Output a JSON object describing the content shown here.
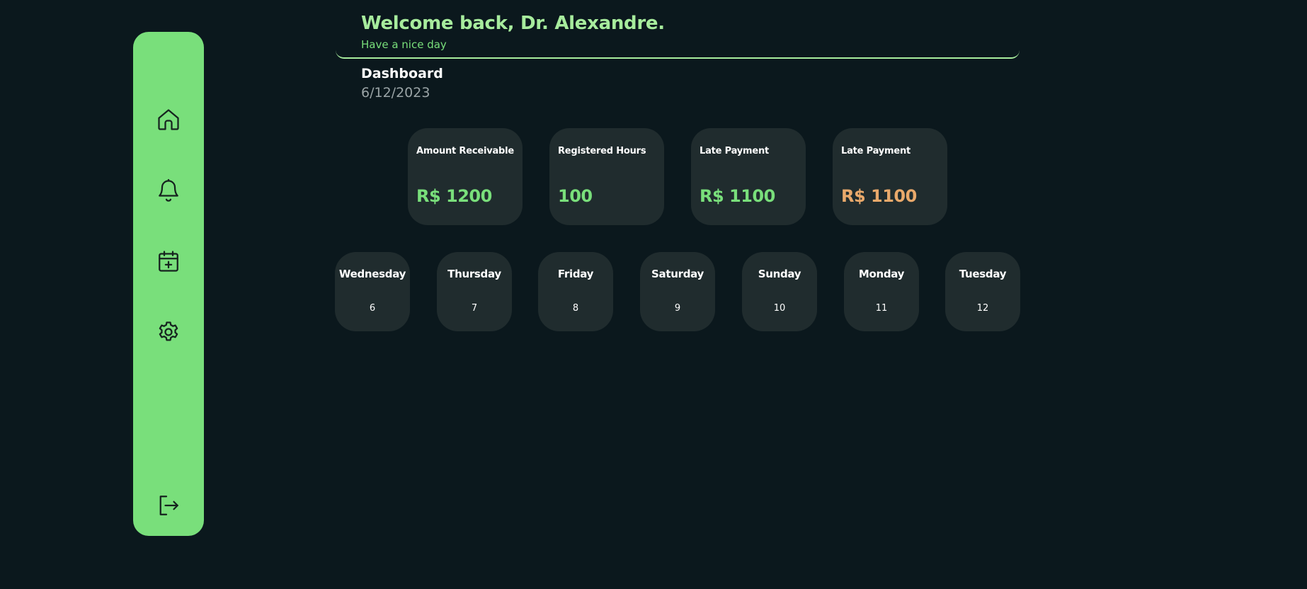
{
  "sidebar": {
    "items": [
      {
        "icon": "home-icon"
      },
      {
        "icon": "bell-icon"
      },
      {
        "icon": "calendar-plus-icon"
      },
      {
        "icon": "gear-icon"
      },
      {
        "icon": "logout-icon"
      }
    ]
  },
  "header": {
    "welcome": "Welcome back, Dr. Alexandre.",
    "subtitle": "Have a nice day"
  },
  "page": {
    "title": "Dashboard",
    "date": "6/12/2023"
  },
  "stats": [
    {
      "label": "Amount Receivable",
      "value": "R$ 1200",
      "color": "#79df7b"
    },
    {
      "label": "Registered Hours",
      "value": "100",
      "color": "#79df7b"
    },
    {
      "label": "Late Payment",
      "value": "R$ 1100",
      "color": "#79df7b"
    },
    {
      "label": "Late Payment",
      "value": "R$ 1100",
      "color": "#e9a96b"
    }
  ],
  "days": [
    {
      "name": "Wednesday",
      "number": "6"
    },
    {
      "name": "Thursday",
      "number": "7"
    },
    {
      "name": "Friday",
      "number": "8"
    },
    {
      "name": "Saturday",
      "number": "9"
    },
    {
      "name": "Sunday",
      "number": "10"
    },
    {
      "name": "Monday",
      "number": "11"
    },
    {
      "name": "Tuesday",
      "number": "12"
    }
  ],
  "colors": {
    "background": "#0b181d",
    "accent": "#79df7b",
    "accent_light": "#a7ec9d",
    "card": "#202c2e",
    "warning": "#e9a96b"
  }
}
